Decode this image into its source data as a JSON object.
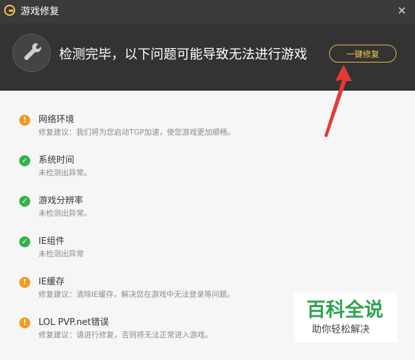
{
  "window": {
    "title": "游戏修复",
    "close_symbol": "✕"
  },
  "header": {
    "message": "检测完毕，以下问题可能导致无法进行游戏",
    "fix_button_label": "一键修复"
  },
  "items": [
    {
      "status": "warning",
      "status_symbol": "!",
      "title": "网络环境",
      "description": "修复建议：我们将为您启动TGP加速，使您游戏更加顺畅。"
    },
    {
      "status": "ok",
      "status_symbol": "✓",
      "title": "系统时间",
      "description": "未检测出异常。"
    },
    {
      "status": "ok",
      "status_symbol": "✓",
      "title": "游戏分辨率",
      "description": "未检测出异常。"
    },
    {
      "status": "ok",
      "status_symbol": "✓",
      "title": "IE组件",
      "description": "未检测出异常"
    },
    {
      "status": "warning",
      "status_symbol": "!",
      "title": "IE缓存",
      "description": "修复建议：清除IE缓存，解决您在游戏中无法登录等问题。"
    },
    {
      "status": "warning",
      "status_symbol": "!",
      "title": "LOL PVP.net错误",
      "description": "修复建议：请进行修复，否则将无法正常进入游戏。"
    }
  ],
  "watermark": {
    "title": "百科全说",
    "subtitle": "助你轻松解决"
  },
  "icons": {
    "logo": "app-logo-icon",
    "wrench": "wrench-icon",
    "close": "close-icon",
    "warning": "warning-icon",
    "ok": "check-icon"
  },
  "colors": {
    "accent": "#f1c94a",
    "warning": "#f29b1f",
    "ok": "#34b24a",
    "annotation_arrow": "#e53935",
    "watermark_green": "#2ea44f"
  }
}
